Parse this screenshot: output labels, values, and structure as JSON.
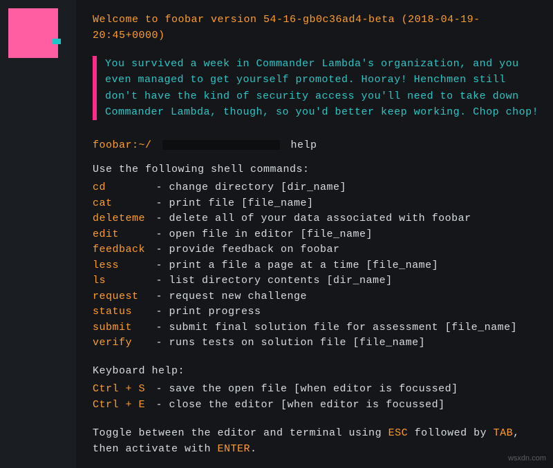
{
  "welcome": "Welcome to foobar version 54-16-gb0c36ad4-beta (2018-04-19-20:45+0000)",
  "message": "You survived a week in Commander Lambda's organization, and you even managed to get yourself promoted. Hooray! Henchmen still don't have the kind of security access you'll need to take down Commander Lambda, though, so you'd better keep working. Chop chop!",
  "prompt": {
    "path": "foobar:~/",
    "command": "help"
  },
  "help": {
    "intro": "Use the following shell commands:",
    "commands": [
      {
        "name": "cd",
        "desc": "change directory [dir_name]"
      },
      {
        "name": "cat",
        "desc": "print file [file_name]"
      },
      {
        "name": "deleteme",
        "desc": "delete all of your data associated with foobar"
      },
      {
        "name": "edit",
        "desc": "open file in editor [file_name]"
      },
      {
        "name": "feedback",
        "desc": "provide feedback on foobar"
      },
      {
        "name": "less",
        "desc": "print a file a page at a time [file_name]"
      },
      {
        "name": "ls",
        "desc": "list directory contents [dir_name]"
      },
      {
        "name": "request",
        "desc": "request new challenge"
      },
      {
        "name": "status",
        "desc": "print progress"
      },
      {
        "name": "submit",
        "desc": "submit final solution file for assessment [file_name]"
      },
      {
        "name": "verify",
        "desc": "runs tests on solution file [file_name]"
      }
    ],
    "keyboard_intro": "Keyboard help:",
    "keyboard": [
      {
        "name": "Ctrl + S",
        "desc": "save the open file [when editor is focussed]"
      },
      {
        "name": "Ctrl + E",
        "desc": "close the editor [when editor is focussed]"
      }
    ],
    "toggle": {
      "pre": "Toggle between the editor and terminal using ",
      "k1": "ESC",
      "mid1": " followed by ",
      "k2": "TAB",
      "mid2": ", then activate with ",
      "k3": "ENTER",
      "post": "."
    }
  },
  "watermark": "wsxdn.com"
}
